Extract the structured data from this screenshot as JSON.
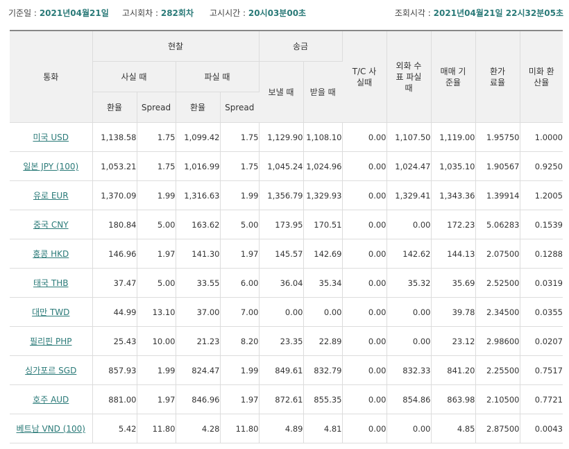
{
  "header": {
    "base_date_label": "기준일 :",
    "base_date_value": "2021년04월21일",
    "round_label": "고시회차 :",
    "round_value": "282회차",
    "time_label": "고시시간 :",
    "time_value": "20시03분00초",
    "query_label": "조회시각 :",
    "query_value": "2021년04월21일 22시32분05초"
  },
  "columns": {
    "currency": "통화",
    "cash": "현찰",
    "remit": "송금",
    "tc_buy": "T/C 사실때",
    "foreign_check_sell": "외화 수표 파실때",
    "base_rate": "매매 기준율",
    "conversion_rate": "환가 료율",
    "usd_rate": "미화 환산율",
    "cash_buy": "사실 때",
    "cash_sell": "파실 때",
    "remit_send": "보낼 때",
    "remit_receive": "받을 때",
    "rate": "환율",
    "spread": "Spread"
  },
  "rows": [
    {
      "currency": "미국 USD",
      "cash_buy": "1,138.58",
      "cash_buy_spread": "1.75",
      "cash_sell": "1,099.42",
      "cash_sell_spread": "1.75",
      "send": "1,129.90",
      "receive": "1,108.10",
      "tc": "0.00",
      "check": "1,107.50",
      "base": "1,119.00",
      "conv": "1.95750",
      "usd": "1.0000"
    },
    {
      "currency": "일본 JPY (100)",
      "cash_buy": "1,053.21",
      "cash_buy_spread": "1.75",
      "cash_sell": "1,016.99",
      "cash_sell_spread": "1.75",
      "send": "1,045.24",
      "receive": "1,024.96",
      "tc": "0.00",
      "check": "1,024.47",
      "base": "1,035.10",
      "conv": "1.90567",
      "usd": "0.9250"
    },
    {
      "currency": "유로 EUR",
      "cash_buy": "1,370.09",
      "cash_buy_spread": "1.99",
      "cash_sell": "1,316.63",
      "cash_sell_spread": "1.99",
      "send": "1,356.79",
      "receive": "1,329.93",
      "tc": "0.00",
      "check": "1,329.41",
      "base": "1,343.36",
      "conv": "1.39914",
      "usd": "1.2005"
    },
    {
      "currency": "중국 CNY",
      "cash_buy": "180.84",
      "cash_buy_spread": "5.00",
      "cash_sell": "163.62",
      "cash_sell_spread": "5.00",
      "send": "173.95",
      "receive": "170.51",
      "tc": "0.00",
      "check": "0.00",
      "base": "172.23",
      "conv": "5.06283",
      "usd": "0.1539"
    },
    {
      "currency": "홍콩 HKD",
      "cash_buy": "146.96",
      "cash_buy_spread": "1.97",
      "cash_sell": "141.30",
      "cash_sell_spread": "1.97",
      "send": "145.57",
      "receive": "142.69",
      "tc": "0.00",
      "check": "142.62",
      "base": "144.13",
      "conv": "2.07500",
      "usd": "0.1288"
    },
    {
      "currency": "태국 THB",
      "cash_buy": "37.47",
      "cash_buy_spread": "5.00",
      "cash_sell": "33.55",
      "cash_sell_spread": "6.00",
      "send": "36.04",
      "receive": "35.34",
      "tc": "0.00",
      "check": "35.32",
      "base": "35.69",
      "conv": "2.52500",
      "usd": "0.0319"
    },
    {
      "currency": "대만 TWD",
      "cash_buy": "44.99",
      "cash_buy_spread": "13.10",
      "cash_sell": "37.00",
      "cash_sell_spread": "7.00",
      "send": "0.00",
      "receive": "0.00",
      "tc": "0.00",
      "check": "0.00",
      "base": "39.78",
      "conv": "2.34500",
      "usd": "0.0355"
    },
    {
      "currency": "필리핀 PHP",
      "cash_buy": "25.43",
      "cash_buy_spread": "10.00",
      "cash_sell": "21.23",
      "cash_sell_spread": "8.20",
      "send": "23.35",
      "receive": "22.89",
      "tc": "0.00",
      "check": "0.00",
      "base": "23.12",
      "conv": "2.98600",
      "usd": "0.0207"
    },
    {
      "currency": "싱가포르 SGD",
      "cash_buy": "857.93",
      "cash_buy_spread": "1.99",
      "cash_sell": "824.47",
      "cash_sell_spread": "1.99",
      "send": "849.61",
      "receive": "832.79",
      "tc": "0.00",
      "check": "832.33",
      "base": "841.20",
      "conv": "2.25500",
      "usd": "0.7517"
    },
    {
      "currency": "호주 AUD",
      "cash_buy": "881.00",
      "cash_buy_spread": "1.97",
      "cash_sell": "846.96",
      "cash_sell_spread": "1.97",
      "send": "872.61",
      "receive": "855.35",
      "tc": "0.00",
      "check": "854.86",
      "base": "863.98",
      "conv": "2.10500",
      "usd": "0.7721"
    },
    {
      "currency": "베트남 VND (100)",
      "cash_buy": "5.42",
      "cash_buy_spread": "11.80",
      "cash_sell": "4.28",
      "cash_sell_spread": "11.80",
      "send": "4.89",
      "receive": "4.81",
      "tc": "0.00",
      "check": "0.00",
      "base": "4.85",
      "conv": "2.87500",
      "usd": "0.0043"
    }
  ]
}
